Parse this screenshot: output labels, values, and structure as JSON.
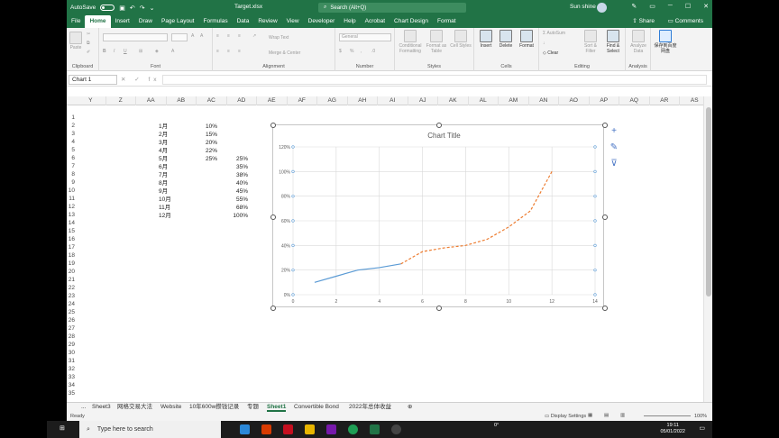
{
  "titlebar": {
    "autosave_label": "AutoSave",
    "autosave_state": "Off",
    "document_title": "Target.xlsx",
    "search_placeholder": "Search (Alt+Q)",
    "user_name": "Sun shine"
  },
  "menubar": {
    "tabs": [
      "File",
      "Home",
      "Insert",
      "Draw",
      "Page Layout",
      "Formulas",
      "Data",
      "Review",
      "View",
      "Developer",
      "Help",
      "Acrobat",
      "Chart Design",
      "Format"
    ],
    "active_tab": "Home",
    "share_label": "Share",
    "comments_label": "Comments"
  },
  "ribbon": {
    "groups": [
      "Clipboard",
      "Font",
      "Alignment",
      "Number",
      "Styles",
      "Cells",
      "Editing",
      "Analysis"
    ],
    "paste_label": "Paste",
    "wrap_text_label": "Wrap Text",
    "merge_center_label": "Merge & Center",
    "number_format_value": "General",
    "conditional_formatting_label": "Conditional Formatting",
    "format_as_table_label": "Format as Table",
    "cell_styles_label": "Cell Styles",
    "insert_label": "Insert",
    "delete_label": "Delete",
    "format_label": "Format",
    "autosum_label": "AutoSum",
    "fill_label": "Fill",
    "clear_label": "Clear",
    "sort_filter_label": "Sort & Filter",
    "find_select_label": "Find & Select",
    "analyze_data_label": "Analyze Data",
    "save_to_baidu_label": "保存到百度网盘"
  },
  "formula_bar": {
    "name_box": "Chart 1",
    "fx_symbols": "✕ ✓ fx"
  },
  "columns": [
    "Y",
    "Z",
    "AA",
    "AB",
    "AC",
    "AD",
    "AE",
    "AF",
    "AG",
    "AH",
    "AI",
    "AJ",
    "AK",
    "AL",
    "AM",
    "AN",
    "AO",
    "AP",
    "AQ",
    "AR",
    "AS"
  ],
  "rows": [
    "1",
    "2",
    "3",
    "4",
    "5",
    "6",
    "7",
    "8",
    "9",
    "10",
    "11",
    "12",
    "13",
    "14",
    "15",
    "16",
    "17",
    "18",
    "19",
    "20",
    "21",
    "22",
    "23",
    "24",
    "25",
    "26",
    "27",
    "28",
    "29",
    "30",
    "31",
    "32",
    "33",
    "34",
    "35"
  ],
  "table": {
    "months": [
      "1月",
      "2月",
      "3月",
      "4月",
      "5月",
      "6月",
      "7月",
      "8月",
      "9月",
      "10月",
      "11月",
      "12月"
    ],
    "col_ac": [
      "10%",
      "15%",
      "20%",
      "22%",
      "25%"
    ],
    "col_ad": [
      "25%",
      "35%",
      "38%",
      "40%",
      "45%",
      "55%",
      "68%",
      "100%"
    ]
  },
  "sheet_tabs": [
    "...",
    "Sheet3",
    "网格交易大法",
    "Website",
    "10年600w攒钱记录",
    "专题",
    "Sheet1",
    "Convertible Bond",
    "2022年总体收益"
  ],
  "active_sheet": "Sheet1",
  "statusbar": {
    "ready": "Ready",
    "display_settings": "Display Settings",
    "zoom": "100%"
  },
  "taskbar": {
    "search_placeholder": "Type here to search",
    "time": "19:11",
    "date": "05/01/2022",
    "weather": "0°"
  },
  "chart_data": {
    "type": "scatter",
    "title": "Chart Title",
    "xlabel": "",
    "ylabel": "",
    "xlim": [
      0,
      14
    ],
    "ylim": [
      0,
      1.2
    ],
    "x_ticks": [
      "0",
      "2",
      "4",
      "6",
      "8",
      "10",
      "12",
      "14"
    ],
    "y_ticks": [
      "0%",
      "20%",
      "40%",
      "60%",
      "80%",
      "100%",
      "120%"
    ],
    "series": [
      {
        "x": [
          1,
          2,
          3,
          4,
          5
        ],
        "y": [
          0.1,
          0.15,
          0.2,
          0.22,
          0.25
        ],
        "color": "#5b9bd5",
        "style": "solid"
      },
      {
        "x": [
          5,
          6,
          7,
          8,
          9,
          10,
          11,
          12
        ],
        "y": [
          0.25,
          0.35,
          0.38,
          0.4,
          0.45,
          0.55,
          0.68,
          1.0
        ],
        "color": "#ed7d31",
        "style": "dashed"
      }
    ],
    "grid": true,
    "legend": "none"
  }
}
